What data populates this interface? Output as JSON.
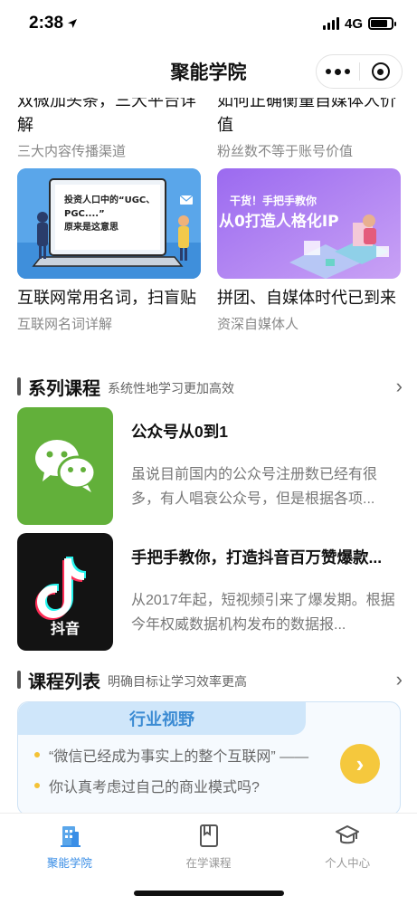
{
  "status": {
    "time": "2:38",
    "network": "4G"
  },
  "nav": {
    "title": "聚能学院"
  },
  "articles_top": [
    {
      "title": "双微加头条，三大平台详解",
      "subtitle": "三大内容传播渠道"
    },
    {
      "title": "如何正确衡量自媒体人价值",
      "subtitle": "粉丝数不等于账号价值"
    }
  ],
  "articles_bottom": [
    {
      "title": "互联网常用名词，扫盲贴",
      "subtitle": "互联网名词详解",
      "thumb_text": "投资人口中的“UGC、PGC....”\n原来是这意思"
    },
    {
      "title": "拼团、自媒体时代已到来",
      "subtitle": "资深自媒体人",
      "thumb_text_1": "干货！手把手教你",
      "thumb_text_2": "从0打造人格化IP"
    }
  ],
  "series": {
    "title": "系列课程",
    "desc": "系统性地学习更加高效",
    "courses": [
      {
        "title": "公众号从0到1",
        "desc": "虽说目前国内的公众号注册数已经有很多，有人唱衰公众号，但是根据各项..."
      },
      {
        "title": "手把手教你，打造抖音百万赞爆款...",
        "desc": "从2017年起，短视频引来了爆发期。根据今年权威数据机构发布的数据报...",
        "thumb_label": "抖音"
      }
    ]
  },
  "course_list": {
    "title": "课程列表",
    "desc": "明确目标让学习效率更高",
    "card_tab": "行业视野",
    "items": [
      "“微信已经成为事实上的整个互联网” ——",
      "你认真考虑过自己的商业模式吗?"
    ]
  },
  "tabbar": {
    "items": [
      {
        "label": "聚能学院",
        "icon": "building-icon"
      },
      {
        "label": "在学课程",
        "icon": "book-icon"
      },
      {
        "label": "个人中心",
        "icon": "graduation-cap-icon"
      }
    ]
  },
  "colors": {
    "accent": "#3a8ee6",
    "wechat_green": "#62b03a",
    "yellow": "#f5c83d"
  }
}
